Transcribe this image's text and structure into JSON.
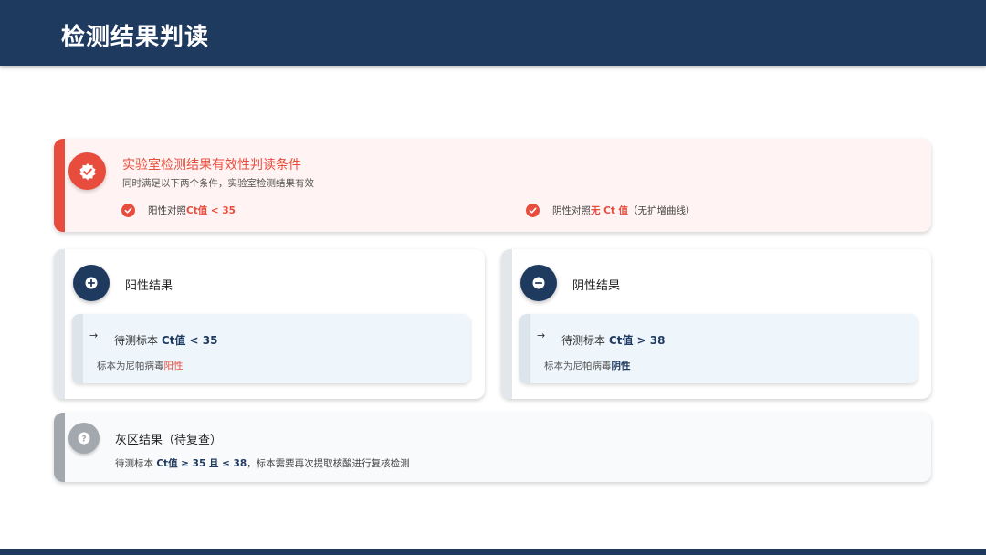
{
  "header": {
    "title": "检测结果判读"
  },
  "validity": {
    "title": "实验室检测结果有效性判读条件",
    "subtitle": "同时满足以下两个条件，实验室检测结果有效",
    "conditions": [
      {
        "text": "阳性对照 ",
        "highlight": "Ct值 < 35",
        "suffix": ""
      },
      {
        "text": "阴性对照",
        "highlight": "无 Ct 值",
        "suffix": "（无扩增曲线）"
      }
    ]
  },
  "positive": {
    "title": "阳性结果",
    "line1_prefix": "待测标本 ",
    "line1_value": "Ct值 < 35",
    "line2_prefix": "标本为尼帕病毒",
    "line2_result": "阳性"
  },
  "negative": {
    "title": "阴性结果",
    "line1_prefix": "待测标本 ",
    "line1_value": "Ct值 > 38",
    "line2_prefix": "标本为尼帕病毒",
    "line2_result": "阴性"
  },
  "grey_zone": {
    "title": "灰区结果（待复查）",
    "prefix": "待测标本 ",
    "value": "Ct值 ≥ 35 且 ≤ 38",
    "suffix": "，标本需要再次提取核酸进行复核检测"
  },
  "colors": {
    "navy": "#1f3a5f",
    "red": "#e84c3d",
    "grey": "#a3a8ae"
  }
}
